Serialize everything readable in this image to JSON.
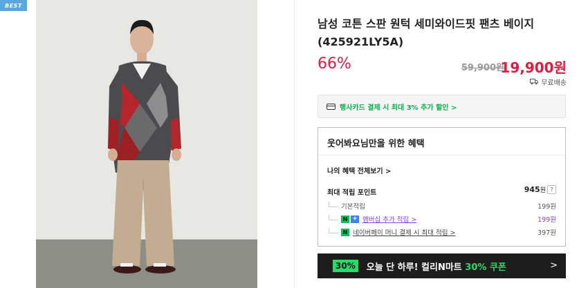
{
  "badge": {
    "label": "BEST"
  },
  "product": {
    "title": "남성 코튼 스판 원턱 세미와이드핏 팬츠 베이지 (425921LY5A)",
    "discount": "66%",
    "original_price": "59,900원",
    "sale_price": "19,900원",
    "delivery": "무료배송"
  },
  "promo": {
    "card_text": "행사카드 결제 시 최대 3% 추가 할인 >"
  },
  "benefits": {
    "title": "웃어봐요님만을 위한 혜택",
    "all_link": "나의 혜택 전체보기 >",
    "max_label": "최대 적립 포인트",
    "max_value": "945",
    "max_unit": "원",
    "help": "?",
    "rows": [
      {
        "label": "기본적립",
        "value": "199원"
      },
      {
        "label": "멤버십 추가 적립 >",
        "value": "199원"
      },
      {
        "label": "네이버페이 머니 결제 시 최대 적립 >",
        "value": "397원"
      }
    ]
  },
  "coupon": {
    "badge": "30%",
    "text_prefix": "오늘 단 하루! 컬리N마트 ",
    "text_accent": "30% 쿠폰",
    "arrow": ">"
  },
  "colors": {
    "discount": "#e3193f",
    "accent_green": "#2bd96b",
    "badge_blue": "#5aa7e0"
  }
}
